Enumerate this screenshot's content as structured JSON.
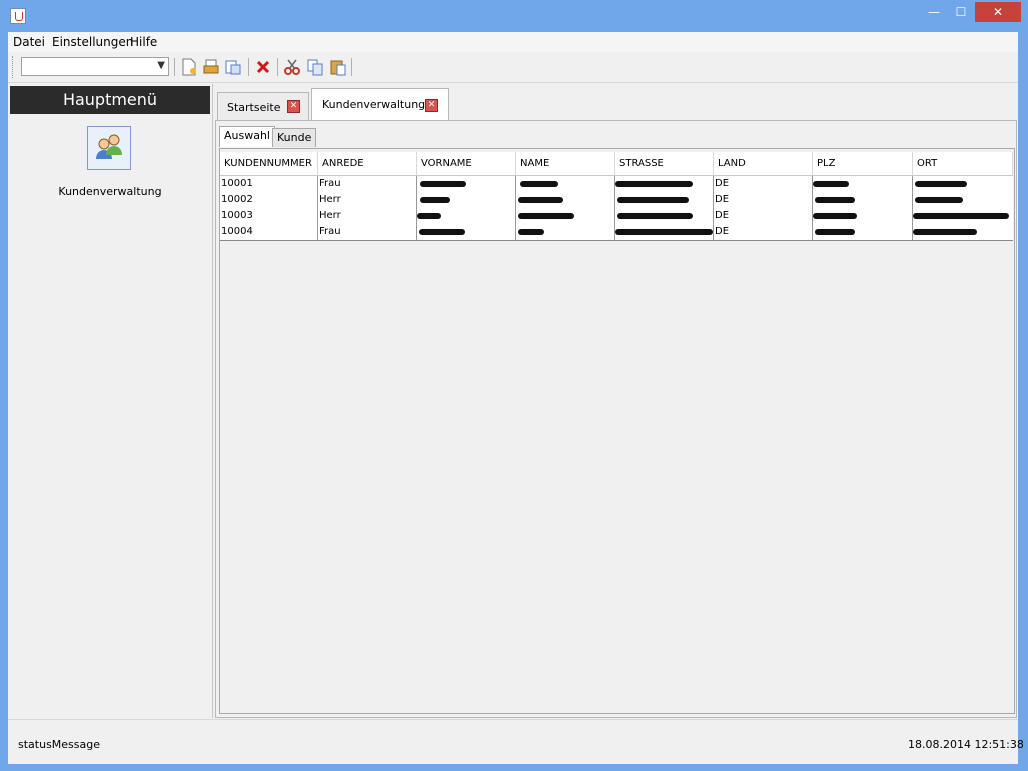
{
  "window": {
    "minimize": "—",
    "maximize": "☐",
    "close": "✕"
  },
  "menubar": {
    "items": [
      "Datei",
      "Einstellungen",
      "Hilfe"
    ]
  },
  "toolbar": {
    "combo_value": ""
  },
  "sidebar": {
    "title": "Hauptmenü",
    "item_label": "Kundenverwaltung"
  },
  "tabs": [
    {
      "label": "Startseite",
      "close": "✕"
    },
    {
      "label": "Kundenverwaltung",
      "close": "✕"
    }
  ],
  "subtabs": [
    "Auswahl",
    "Kunde"
  ],
  "table": {
    "columns": [
      "KUNDENNUMMER",
      "ANREDE",
      "VORNAME",
      "NAME",
      "STRASSE",
      "LAND",
      "PLZ",
      "ORT"
    ],
    "rows": [
      {
        "kundennummer": "10001",
        "anrede": "Frau",
        "land": "DE"
      },
      {
        "kundennummer": "10002",
        "anrede": "Herr",
        "land": "DE"
      },
      {
        "kundennummer": "10003",
        "anrede": "Herr",
        "land": "DE"
      },
      {
        "kundennummer": "10004",
        "anrede": "Frau",
        "land": "DE"
      }
    ]
  },
  "status": {
    "message": "statusMessage",
    "datetime": "18.08.2014 12:51:38"
  },
  "colors": {
    "titlebar": "#6fa7ea",
    "close_button": "#c7423a",
    "hauptmenu_bg": "#2b2b2b"
  }
}
